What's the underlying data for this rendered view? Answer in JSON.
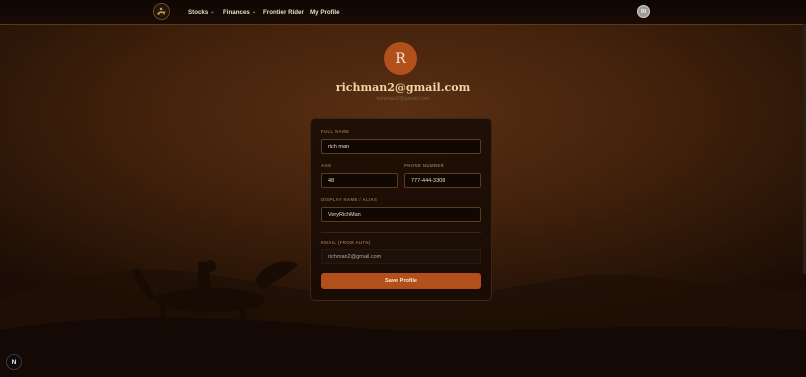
{
  "nav": {
    "items": [
      {
        "label": "Stocks",
        "has_dropdown": true
      },
      {
        "label": "Finances",
        "has_dropdown": true
      },
      {
        "label": "Frontier Rider",
        "has_dropdown": false
      },
      {
        "label": "My Profile",
        "has_dropdown": false
      }
    ],
    "avatar_initial": "RI"
  },
  "profile": {
    "avatar_initial": "R",
    "email_title": "richman2@gmail.com",
    "email_subtitle": "richman2@gmail.com"
  },
  "form": {
    "full_name": {
      "label": "FULL NAME",
      "value": "rich man"
    },
    "age": {
      "label": "AGE",
      "value": "48"
    },
    "phone": {
      "label": "PHONE NUMBER",
      "value": "777-444-3308"
    },
    "display_name": {
      "label": "DISPLAY NAME / ALIAS",
      "value": "VeryRichMan"
    },
    "email": {
      "label": "EMAIL (FROM AUTH)",
      "value": "richman2@gmail.com"
    },
    "save_label": "Save Profile"
  },
  "dev_badge": "N",
  "colors": {
    "accent": "#b1501a",
    "title_gold": "#f0d6a8",
    "background": "#43220c"
  }
}
